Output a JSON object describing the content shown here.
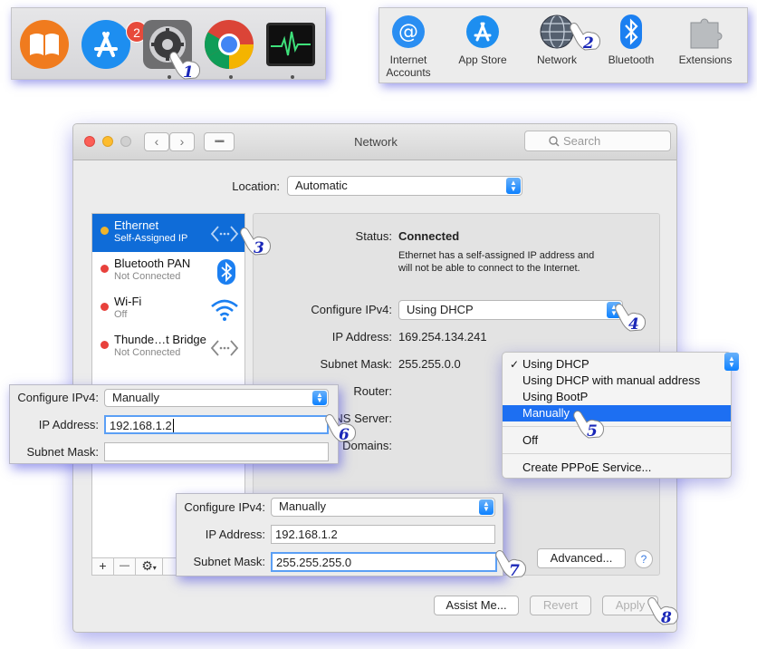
{
  "dock": {
    "icons": [
      {
        "name": "books-icon"
      },
      {
        "name": "app-store-icon",
        "badge": "2"
      },
      {
        "name": "system-preferences-icon"
      },
      {
        "name": "chrome-icon"
      },
      {
        "name": "activity-monitor-icon"
      }
    ]
  },
  "prefs_panes": {
    "items": [
      {
        "label": "Internet\nAccounts",
        "icon": "at-sign-icon"
      },
      {
        "label": "App Store",
        "icon": "app-store-icon"
      },
      {
        "label": "Network",
        "icon": "globe-icon"
      },
      {
        "label": "Bluetooth",
        "icon": "bluetooth-icon"
      },
      {
        "label": "Extensions",
        "icon": "puzzle-icon"
      }
    ]
  },
  "window": {
    "title": "Network",
    "search_placeholder": "Search",
    "location_label": "Location:",
    "location_value": "Automatic",
    "services": [
      {
        "name": "Ethernet",
        "status": "Self-Assigned IP",
        "dot": "#f0b42b",
        "icon": "ethernet-icon",
        "selected": true
      },
      {
        "name": "Bluetooth PAN",
        "status": "Not Connected",
        "dot": "#e8413c",
        "icon": "bluetooth-icon"
      },
      {
        "name": "Wi-Fi",
        "status": "Off",
        "dot": "#e8413c",
        "icon": "wifi-icon"
      },
      {
        "name": "Thunde…t Bridge",
        "status": "Not Connected",
        "dot": "#e8413c",
        "icon": "thunderbolt-bridge-icon"
      }
    ],
    "status_label": "Status:",
    "status_value": "Connected",
    "status_desc_1": "Ethernet has a self-assigned IP address and",
    "status_desc_2": "will not be able to connect to the Internet.",
    "configure_label": "Configure IPv4:",
    "configure_value": "Using DHCP",
    "ip_label": "IP Address:",
    "ip_value": "169.254.134.241",
    "subnet_label": "Subnet Mask:",
    "subnet_value": "255.255.0.0",
    "router_label": "Router:",
    "dns_label_partial": "NS Server:",
    "domains_label_partial": "Domains:",
    "advanced_button": "Advanced...",
    "help_button": "?",
    "assist_button": "Assist Me...",
    "revert_button": "Revert",
    "apply_button": "Apply",
    "plus": "+",
    "minus": "—",
    "gear": "⚙"
  },
  "menu": {
    "items": [
      "Using DHCP",
      "Using DHCP with manual address",
      "Using BootP",
      "Manually",
      "Off",
      "Create PPPoE Service..."
    ],
    "checked": "✓"
  },
  "panel_a": {
    "configure_label": "Configure IPv4:",
    "configure_value": "Manually",
    "ip_label": "IP Address:",
    "ip_value": "192.168.1.2",
    "subnet_label": "Subnet Mask:",
    "subnet_value": ""
  },
  "panel_b": {
    "configure_label": "Configure IPv4:",
    "configure_value": "Manually",
    "ip_label": "IP Address:",
    "ip_value": "192.168.1.2",
    "subnet_label": "Subnet Mask:",
    "subnet_value": "255.255.255.0"
  },
  "steps": [
    "1",
    "2",
    "3",
    "4",
    "5",
    "6",
    "7",
    "8"
  ]
}
